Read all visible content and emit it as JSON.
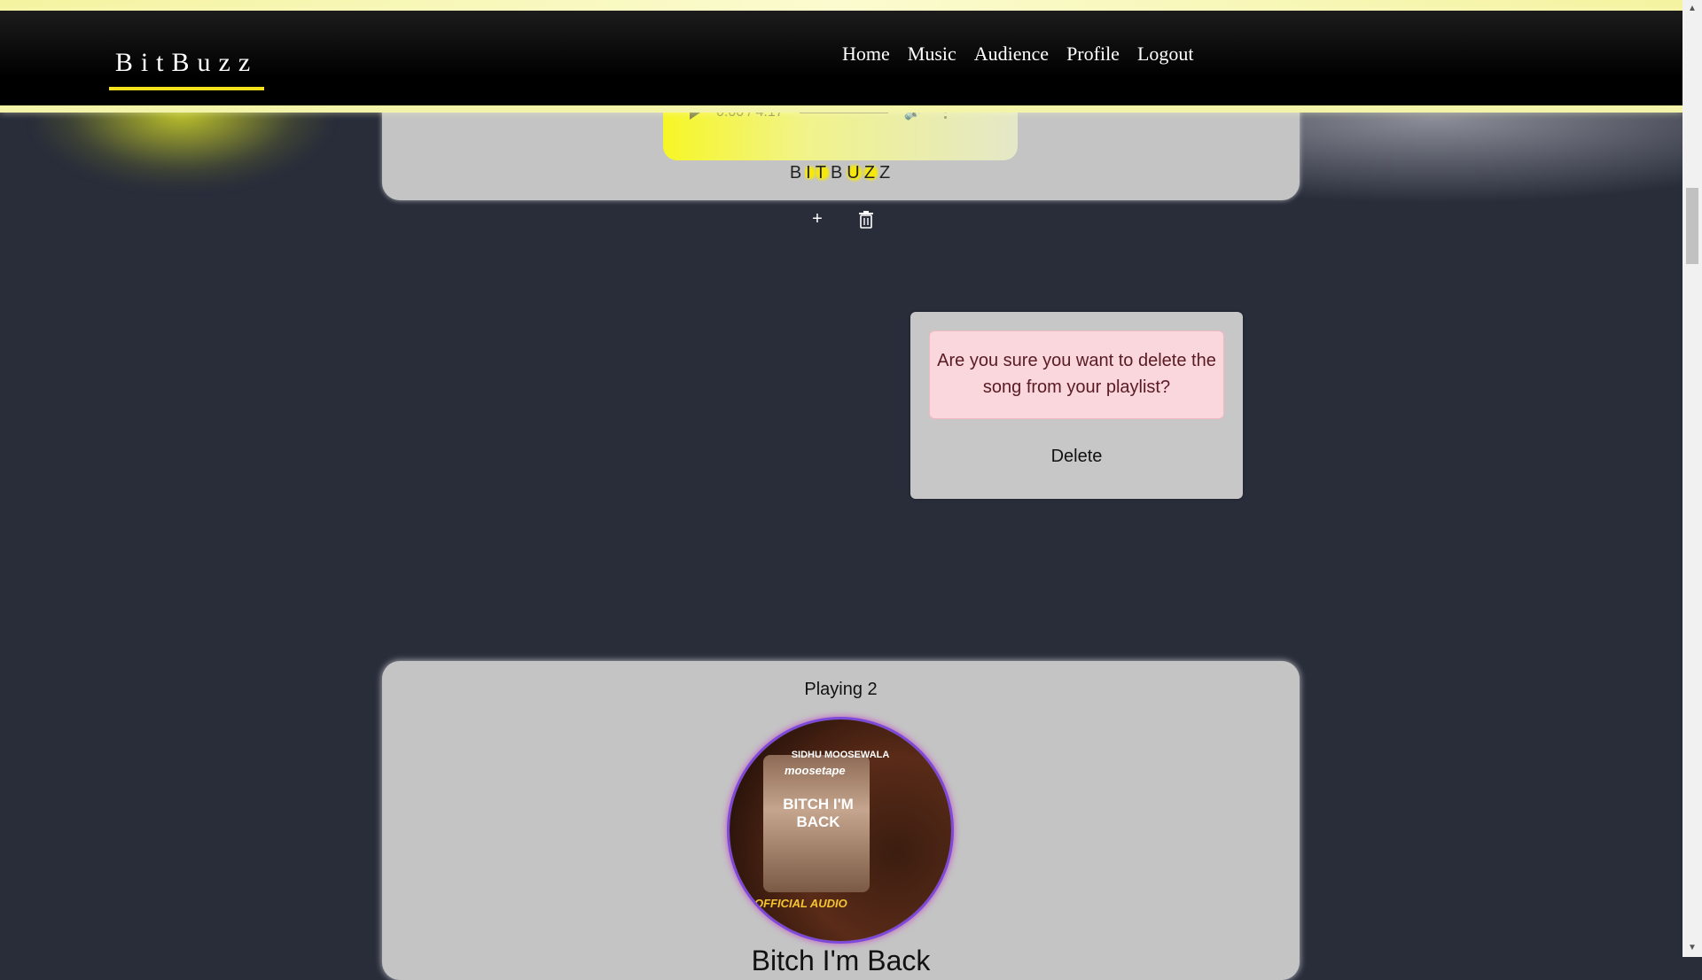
{
  "navbar": {
    "brand": "BitBuzz",
    "links": [
      "Home",
      "Music",
      "Audience",
      "Profile",
      "Logout"
    ]
  },
  "player": {
    "time": "0:00 / 4:17",
    "icons": [
      "play-icon",
      "volume-icon",
      "more-options-icon"
    ]
  },
  "card1": {
    "logo_letters": [
      "B",
      "I",
      "T",
      "B",
      "U",
      "Z",
      "Z"
    ],
    "add_label": "+",
    "icons": [
      "trash-icon"
    ]
  },
  "modal": {
    "message": "Are you sure you want to delete the song from your playlist?",
    "delete_label": "Delete"
  },
  "card2": {
    "playing_label": "Playing 2",
    "song_title": "Bitch I'm Back",
    "album_art": {
      "artist": "SIDHU MOOSEWALA",
      "series": "moosetape",
      "title": "BITCH I'M BACK",
      "tag": "OFFICIAL AUDIO"
    }
  },
  "colors": {
    "accent": "#f5e21d",
    "background": "#292d3a",
    "card": "#c4c4c4",
    "alert_bg": "#f9d7dc"
  }
}
